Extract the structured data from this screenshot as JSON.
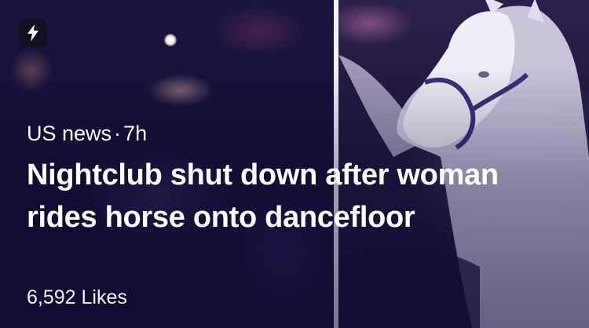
{
  "story": {
    "category": "US news",
    "separator": "·",
    "age": "7h",
    "headline": "Nightclub shut down after woman rides horse onto dancefloor",
    "likes": "6,592 Likes"
  },
  "icons": {
    "source": "lightning-bolt-icon"
  },
  "colors": {
    "text": "#ffffff",
    "badge_background": "#12101a",
    "divider": "#f4f2f8",
    "overlay": "#140e3c"
  }
}
